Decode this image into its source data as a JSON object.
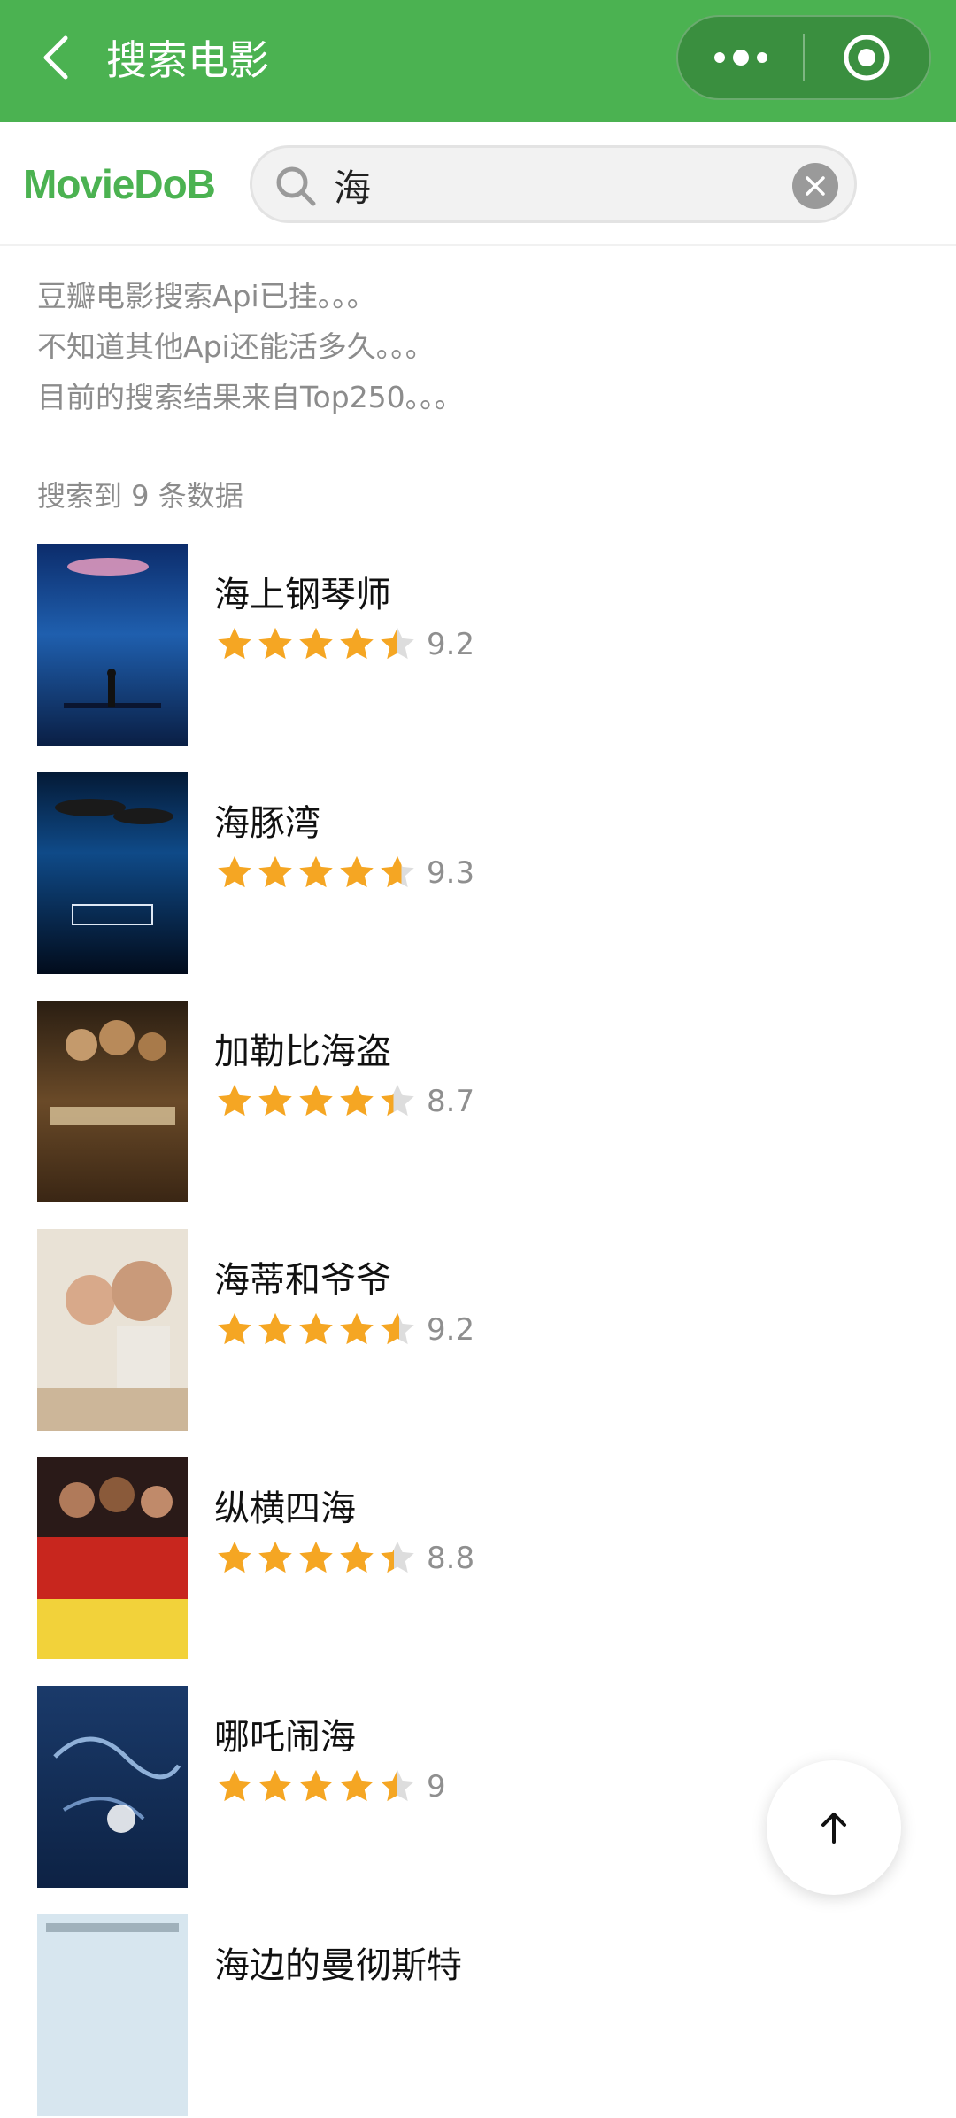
{
  "navbar": {
    "title": "搜索电影",
    "back_icon": "chevron-left-icon",
    "more_icon": "more-dots-icon",
    "close_icon": "target-circle-icon"
  },
  "header": {
    "brand": "MovieDoB",
    "search": {
      "value": "海",
      "placeholder": ""
    }
  },
  "notice": {
    "lines": [
      "豆瓣电影搜索Api已挂。。。",
      "不知道其他Api还能活多久。。。",
      "目前的搜索结果来自Top250。。。"
    ]
  },
  "results": {
    "count_text": "搜索到 9 条数据",
    "movies": [
      {
        "title": "海上钢琴师",
        "rating": "9.2",
        "stars": 4.5
      },
      {
        "title": "海豚湾",
        "rating": "9.3",
        "stars": 4.5
      },
      {
        "title": "加勒比海盗",
        "rating": "8.7",
        "stars": 4.5
      },
      {
        "title": "海蒂和爷爷",
        "rating": "9.2",
        "stars": 4.5
      },
      {
        "title": "纵横四海",
        "rating": "8.8",
        "stars": 4.5
      },
      {
        "title": "哪吒闹海",
        "rating": "9",
        "stars": 4.5
      },
      {
        "title": "海边的曼彻斯特",
        "rating": "",
        "stars": 0
      }
    ]
  },
  "colors": {
    "primary_green": "#4bb251",
    "star_orange": "#f5a623",
    "star_gray": "#dddddd"
  }
}
